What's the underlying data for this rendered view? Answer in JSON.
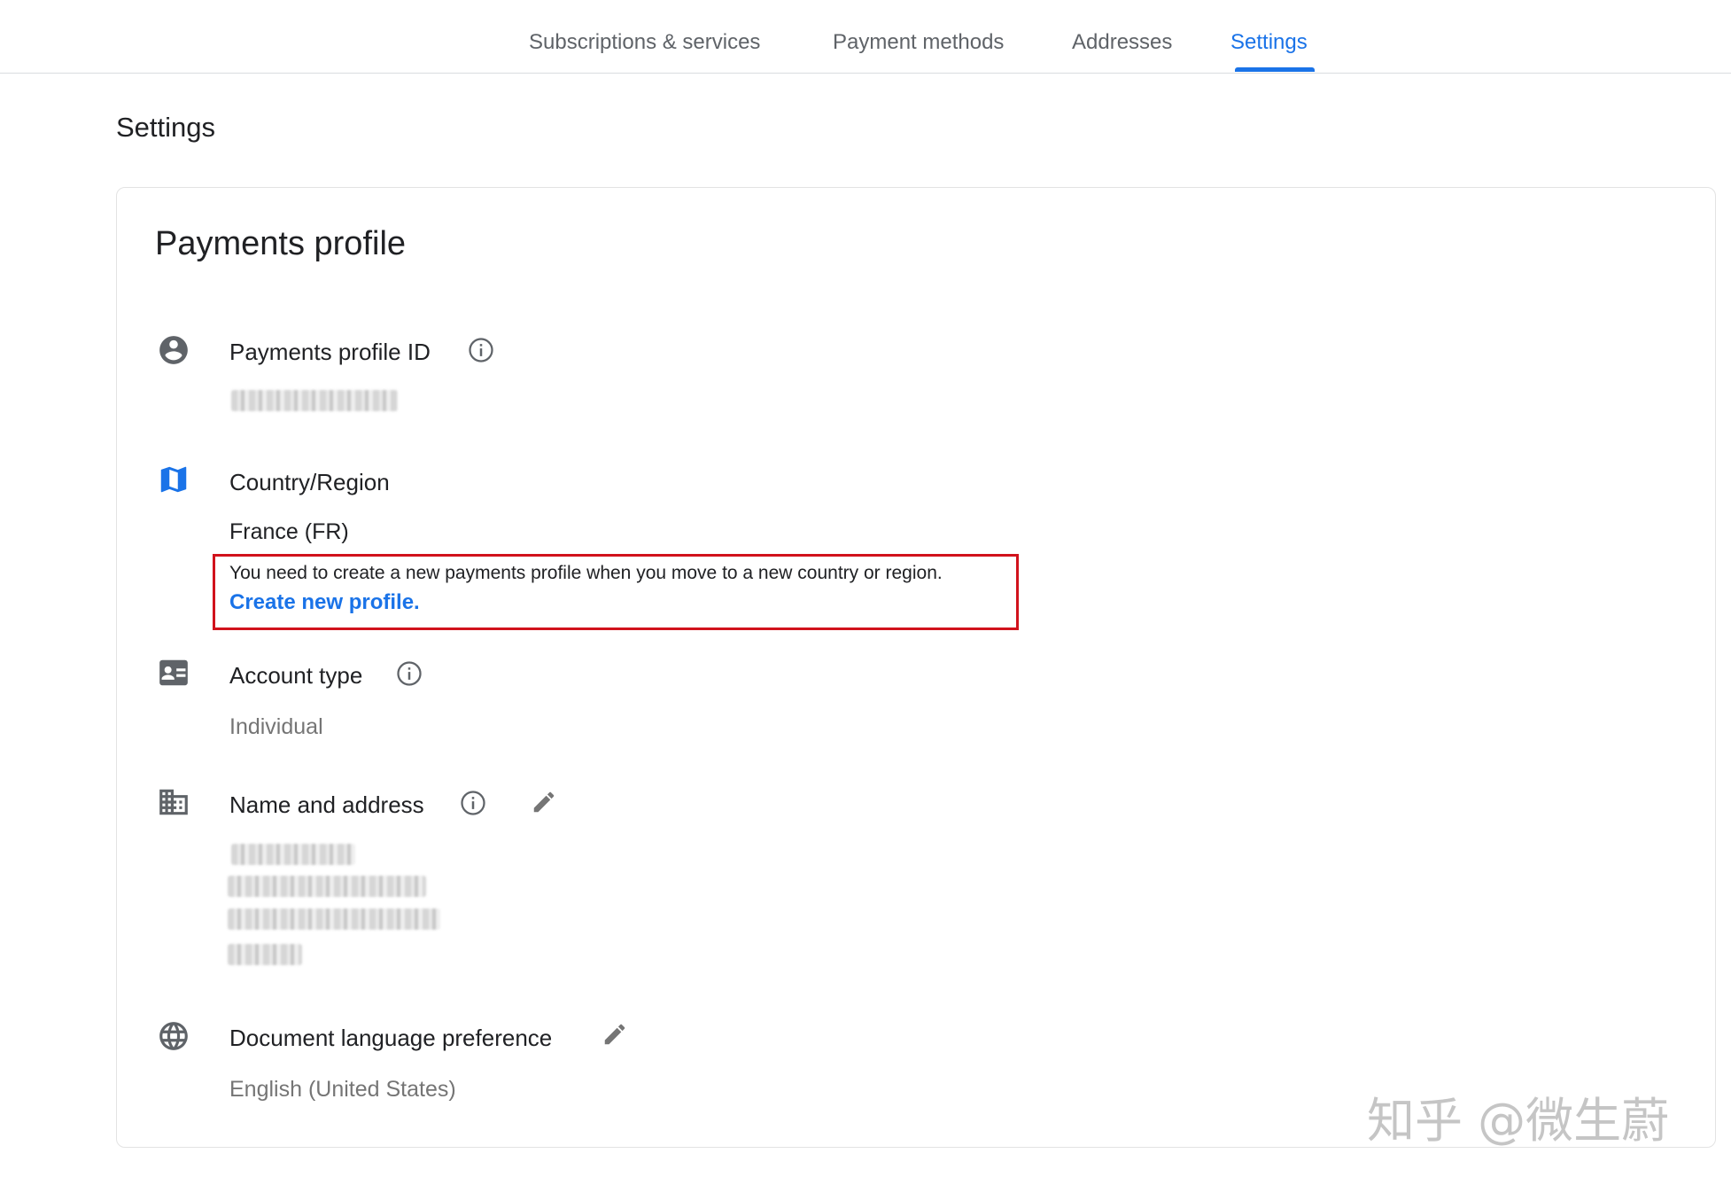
{
  "nav": {
    "tabs": [
      {
        "label": "Subscriptions & services",
        "active": false
      },
      {
        "label": "Payment methods",
        "active": false
      },
      {
        "label": "Addresses",
        "active": false
      },
      {
        "label": "Settings",
        "active": true
      }
    ]
  },
  "page": {
    "title": "Settings"
  },
  "card": {
    "title": "Payments profile",
    "payments_profile_id": {
      "label": "Payments profile ID",
      "icon": "account-circle-icon"
    },
    "country_region": {
      "label": "Country/Region",
      "value": "France (FR)",
      "icon": "map-icon",
      "notice": "You need to create a new payments profile when you move to a new country or region.",
      "link": "Create new profile."
    },
    "account_type": {
      "label": "Account type",
      "value": "Individual",
      "icon": "id-card-icon"
    },
    "name_address": {
      "label": "Name and address",
      "icon": "building-icon"
    },
    "document_language": {
      "label": "Document language preference",
      "value": "English (United States)",
      "icon": "globe-icon"
    }
  },
  "watermark": "知乎 @微生蔚",
  "colors": {
    "accent": "#1a73e8",
    "notice_border": "#d1121c",
    "text": "#202124",
    "secondary": "#757575"
  }
}
